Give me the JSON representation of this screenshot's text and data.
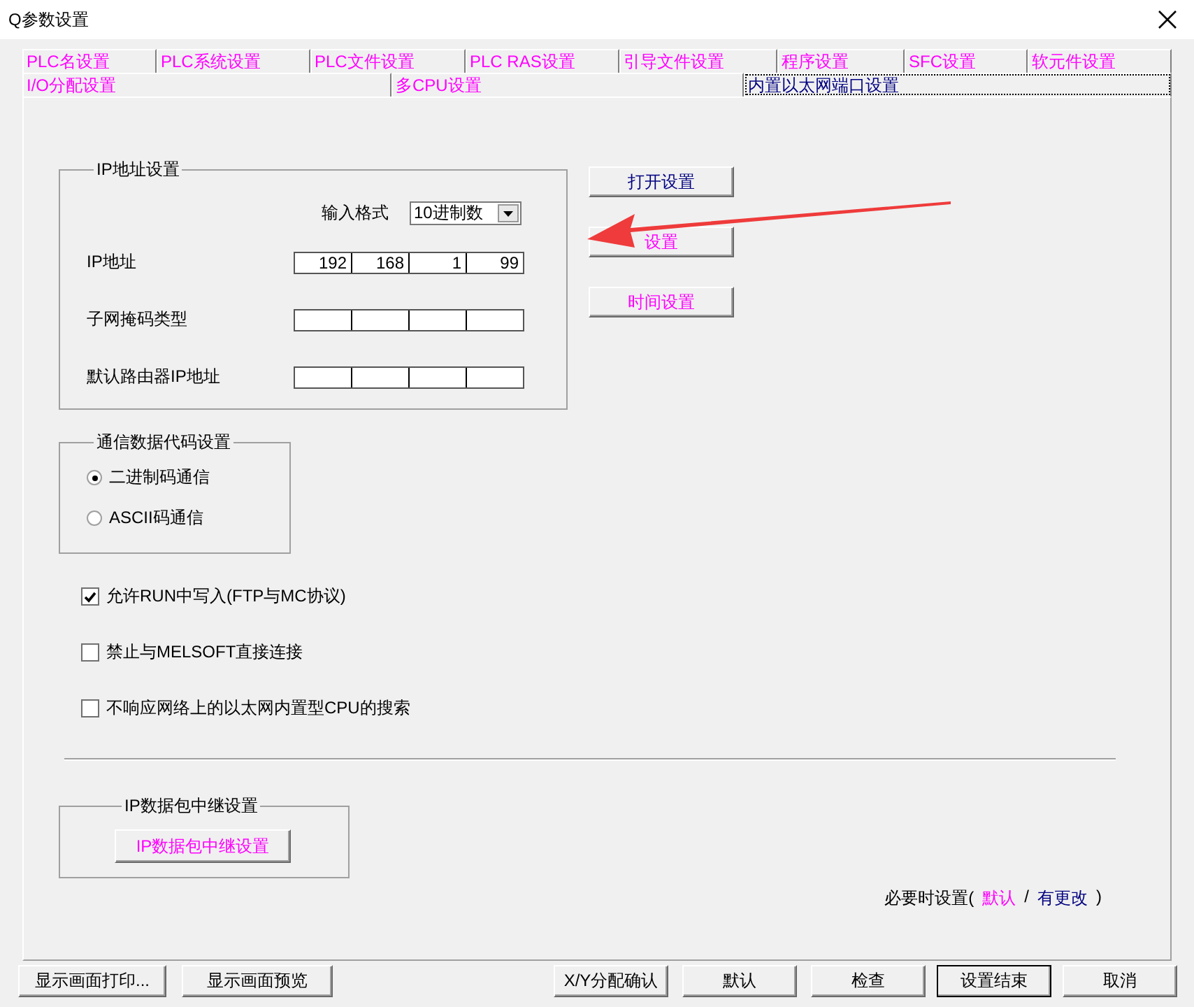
{
  "window": {
    "title": "Q参数设置"
  },
  "tabs": [
    [
      {
        "label": "PLC名设置",
        "selected": false,
        "changed": false
      },
      {
        "label": "PLC系统设置",
        "selected": false,
        "changed": false
      },
      {
        "label": "PLC文件设置",
        "selected": false,
        "changed": false
      },
      {
        "label": "PLC RAS设置",
        "selected": false,
        "changed": false
      },
      {
        "label": "引导文件设置",
        "selected": false,
        "changed": false
      },
      {
        "label": "程序设置",
        "selected": false,
        "changed": false
      },
      {
        "label": "SFC设置",
        "selected": false,
        "changed": false
      },
      {
        "label": "软元件设置",
        "selected": false,
        "changed": false
      }
    ],
    [
      {
        "label": "I/O分配设置",
        "selected": false,
        "changed": false
      },
      {
        "label": "多CPU设置",
        "selected": false,
        "changed": false
      },
      {
        "label": "内置以太网端口设置",
        "selected": true,
        "changed": true
      }
    ]
  ],
  "ip_group": {
    "title": "IP地址设置",
    "input_format_label": "输入格式",
    "input_format_value": "10进制数",
    "rows": [
      {
        "label": "IP地址",
        "octets": [
          "192",
          "168",
          "1",
          "99"
        ]
      },
      {
        "label": "子网掩码类型"
      },
      {
        "label": "默认路由器IP地址"
      }
    ]
  },
  "side_buttons": [
    {
      "label": "打开设置",
      "changed": true
    },
    {
      "label": "设置",
      "changed": false
    },
    {
      "label": "时间设置",
      "changed": false
    }
  ],
  "comm_group": {
    "title": "通信数据代码设置",
    "options": [
      {
        "label": "二进制码通信",
        "selected": true
      },
      {
        "label": "ASCII码通信",
        "selected": false
      }
    ]
  },
  "checkboxes": [
    {
      "label": "允许RUN中写入(FTP与MC协议)",
      "checked": true
    },
    {
      "label": "禁止与MELSOFT直接连接",
      "checked": false
    },
    {
      "label": "不响应网络上的以太网内置型CPU的搜索",
      "checked": false
    }
  ],
  "relay_group": {
    "title": "IP数据包中继设置",
    "button": {
      "label": "IP数据包中继设置",
      "changed": false
    }
  },
  "legend": {
    "prefix": "必要时设置(",
    "default_label": "默认",
    "separator": "/",
    "changed_label": "有更改",
    "suffix": ")"
  },
  "bottom_buttons": [
    {
      "label": "显示画面打印...",
      "default": false
    },
    {
      "label": "显示画面预览",
      "default": false
    },
    {
      "label": "X/Y分配确认",
      "default": false
    },
    {
      "label": "默认",
      "default": false
    },
    {
      "label": "检查",
      "default": false
    },
    {
      "label": "设置结束",
      "default": true
    },
    {
      "label": "取消",
      "default": false
    }
  ]
}
